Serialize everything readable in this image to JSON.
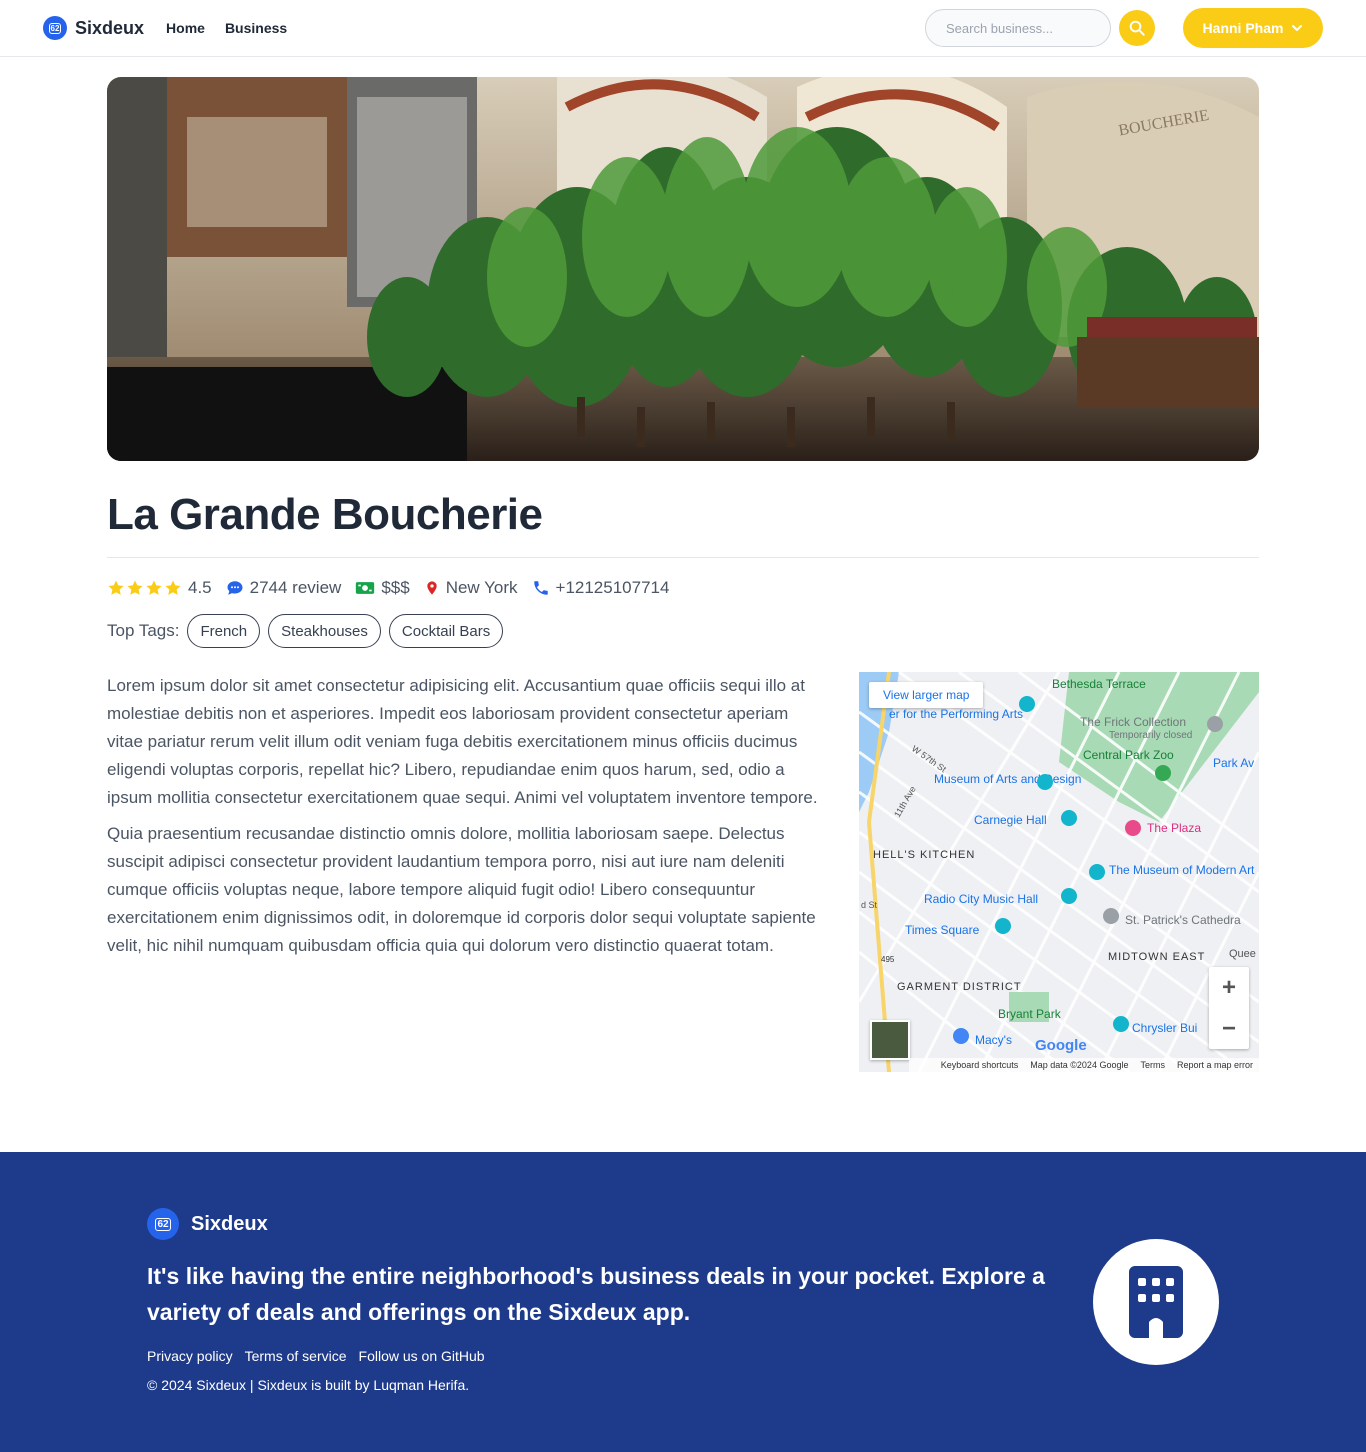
{
  "nav": {
    "brand": "Sixdeux",
    "logo_text": "62",
    "links": [
      {
        "label": "Home"
      },
      {
        "label": "Business"
      }
    ],
    "search_placeholder": "Search business...",
    "user_name": "Hanni Pham"
  },
  "business": {
    "name": "La Grande Boucherie",
    "rating": "4.5",
    "reviews": "2744 review",
    "price": "$$$",
    "location": "New York",
    "phone": "+12125107714",
    "tags_label": "Top Tags:",
    "tags": [
      "French",
      "Steakhouses",
      "Cocktail Bars"
    ],
    "description": [
      "Lorem ipsum dolor sit amet consectetur adipisicing elit. Accusantium quae officiis sequi illo at molestiae debitis non et asperiores. Impedit eos laboriosam provident consectetur aperiam vitae pariatur rerum velit illum odit veniam fuga debitis exercitationem minus officiis ducimus eligendi voluptas corporis, repellat hic? Libero, repudiandae enim quos harum, sed, odio a ipsum mollitia consectetur exercitationem quae sequi. Animi vel voluptatem inventore tempore.",
      "Quia praesentium recusandae distinctio omnis dolore, mollitia laboriosam saepe. Delectus suscipit adipisci consectetur provident laudantium tempora porro, nisi aut iure nam deleniti cumque officiis voluptas neque, labore tempore aliquid fugit odio! Libero consequuntur exercitationem enim dignissimos odit, in doloremque id corporis dolor sequi voluptate sapiente velit, hic nihil numquam quibusdam officia quia qui dolorum vero distinctio quaerat totam."
    ],
    "hero_sign": "BOUCHERIE"
  },
  "map": {
    "view_larger": "View larger map",
    "labels": {
      "performing_arts": "er for the Performing Arts",
      "bethesda": "Bethesda Terrace",
      "frick": "The Frick Collection",
      "frick_note": "Temporarily closed",
      "zoo": "Central Park Zoo",
      "park_av": "Park Av",
      "w57": "W 57th St",
      "ave11": "11th Ave",
      "mad": "Museum of Arts and Design",
      "carnegie": "Carnegie Hall",
      "plaza": "The Plaza",
      "hells_kitchen": "HELL'S KITCHEN",
      "moma": "The Museum of Modern Art",
      "radio_city": "Radio City Music Hall",
      "st_patricks": "St. Patrick's Cathedra",
      "times_square": "Times Square",
      "midtown_east": "MIDTOWN EAST",
      "quee": "Quee",
      "garment": "GARMENT DISTRICT",
      "bryant": "Bryant Park",
      "chrysler": "Chrysler Bui",
      "macys": "Macy's",
      "route": "495",
      "d_st": "d St"
    },
    "attribution": [
      "Keyboard shortcuts",
      "Map data ©2024 Google",
      "Terms",
      "Report a map error"
    ],
    "google": "Google"
  },
  "footer": {
    "brand": "Sixdeux",
    "logo_text": "62",
    "tagline": "It's like having the entire neighborhood's business deals in your pocket. Explore a variety of deals and offerings on the Sixdeux app.",
    "links": [
      "Privacy policy",
      "Terms of service",
      "Follow us on GitHub"
    ],
    "copyright": "© 2024 Sixdeux | Sixdeux is built by Luqman Herifa."
  },
  "colors": {
    "accent": "#facc15",
    "brand_blue": "#2563eb",
    "footer_bg": "#1e3a8a",
    "star": "#facc15",
    "price_icon": "#16a34a",
    "location_icon": "#dc2626",
    "review_icon": "#2563eb"
  },
  "icons": {
    "search": "search-icon",
    "user_dropdown": "chevron-down-icon",
    "star": "star-icon",
    "review": "chat-bubble-icon",
    "price": "money-bill-icon",
    "location": "map-pin-icon",
    "phone": "phone-icon",
    "footer_badge": "building-icon"
  }
}
